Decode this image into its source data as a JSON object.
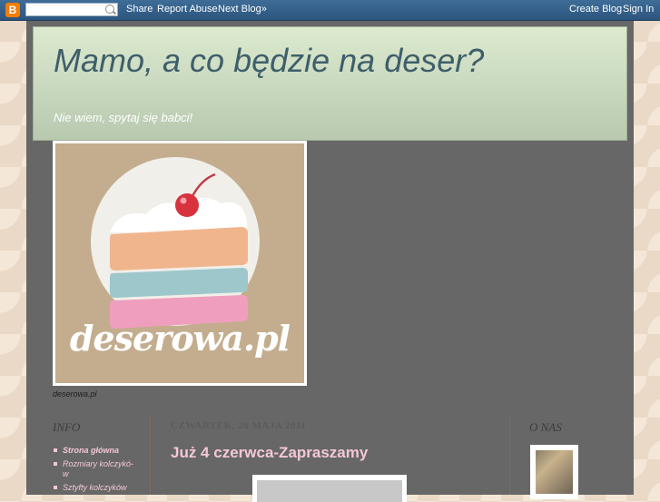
{
  "navbar": {
    "logo_letter": "B",
    "search": {
      "value": "",
      "placeholder": ""
    },
    "share": "Share",
    "report_abuse": "Report Abuse",
    "next_blog": "Next Blog»",
    "create_blog": "Create Blog",
    "sign_in": "Sign In",
    "accent_color": "#f57d00",
    "icons": [
      "blogger-logo-icon",
      "search-icon"
    ]
  },
  "header": {
    "title": "Mamo, a co będzie na deser?",
    "description": "Nie wiem, spytaj się babci!"
  },
  "logo": {
    "text": "deserowa.pl",
    "caption": "deserowa.pl"
  },
  "sidebar": {
    "title": "INFO",
    "items": [
      {
        "label": "Strona główna"
      },
      {
        "label": "Rozmiary kolczykó­w"
      },
      {
        "label": "Sztyfty kolczyków"
      }
    ]
  },
  "post": {
    "date": "CZWARTEK, 26 MAJA 2011",
    "title": "Już 4 czerwca-Zapraszamy"
  },
  "about": {
    "title": "O NAS"
  },
  "colors": {
    "pink_accent": "#f4c7d8",
    "content_bg": "#666766",
    "header_title": "#3e5f6a"
  }
}
